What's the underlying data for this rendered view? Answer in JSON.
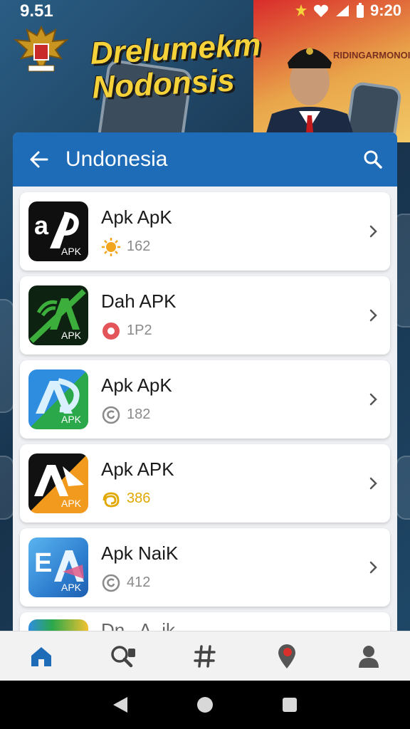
{
  "status_bar": {
    "time_left": "9.51",
    "time_right": "9:20"
  },
  "banner": {
    "headline_line1": "Drelumekm",
    "headline_line2": "Nodonsis",
    "side_text": "RIDINGARMONOI"
  },
  "appbar": {
    "title": "Undonesia"
  },
  "apps": [
    {
      "name": "Apk ApK",
      "icon_letter": "aP",
      "tag": "APK",
      "count": "162",
      "meta_icon": "sun-icon",
      "count_color": "#8a8a8a"
    },
    {
      "name": "Dah APK",
      "icon_letter": "A",
      "tag": "APK",
      "count": "1P2",
      "meta_icon": "record-icon",
      "count_color": "#8a8a8a"
    },
    {
      "name": "Apk ApK",
      "icon_letter": "A",
      "tag": "APK",
      "count": "182",
      "meta_icon": "swirl-icon",
      "count_color": "#8a8a8a"
    },
    {
      "name": "Apk APK",
      "icon_letter": "A",
      "tag": "APK",
      "count": "386",
      "meta_icon": "coin-swirl-icon",
      "count_color": "#e0a800"
    },
    {
      "name": "Apk NaiK",
      "icon_letter": "E",
      "tag": "APK",
      "count": "412",
      "meta_icon": "swirl-icon",
      "count_color": "#8a8a8a"
    },
    {
      "name": "Dn.. A..ik",
      "icon_letter": "",
      "tag": "",
      "count": "",
      "meta_icon": "",
      "count_color": "#8a8a8a"
    }
  ],
  "bottom_nav": [
    "home-icon",
    "search-apps-icon",
    "hashtag-icon",
    "location-pin-icon",
    "profile-icon"
  ],
  "colors": {
    "accent": "#1e6bb8",
    "home_active": "#1e6bb8"
  }
}
